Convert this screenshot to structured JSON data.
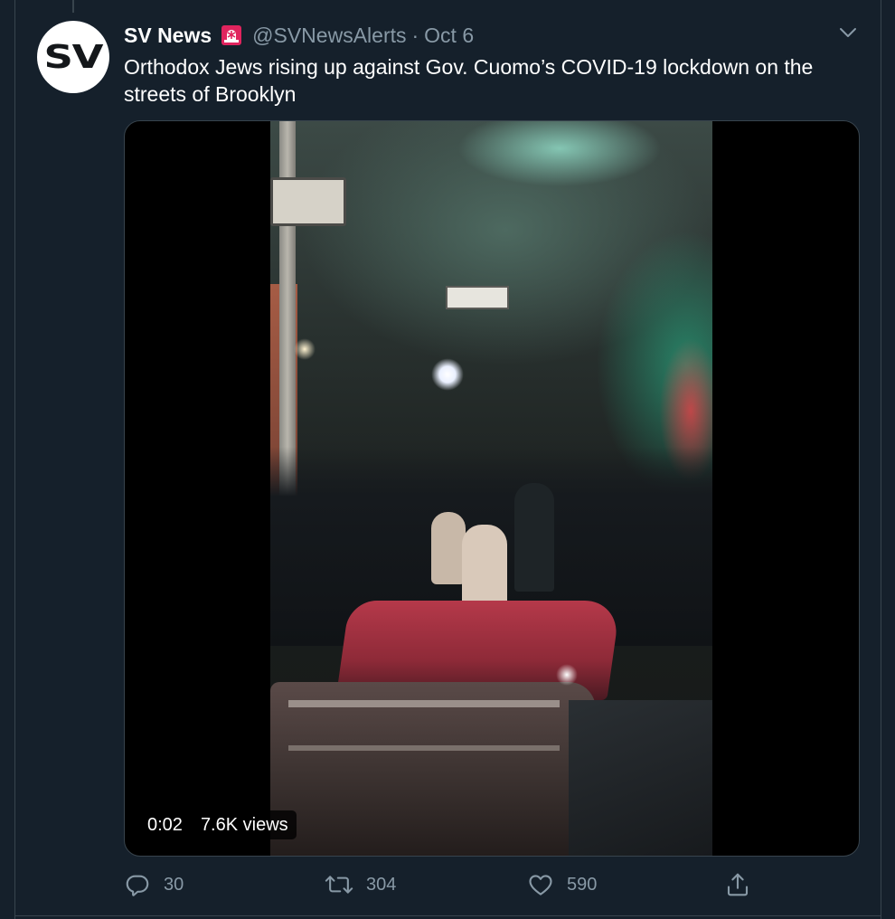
{
  "tweet": {
    "avatar_text": "SV",
    "author_name": "SV News",
    "badge_icon": "rotating-light-icon",
    "handle": "@SVNewsAlerts",
    "separator": "·",
    "date": "Oct 6",
    "text": "Orthodox Jews rising up against Gov. Cuomo’s COVID-19 lockdown on the streets of Brooklyn"
  },
  "video": {
    "duration": "0:02",
    "views": "7.6K views"
  },
  "actions": {
    "reply": {
      "icon": "reply-icon",
      "count": "30"
    },
    "retweet": {
      "icon": "retweet-icon",
      "count": "304"
    },
    "like": {
      "icon": "heart-icon",
      "count": "590"
    },
    "share": {
      "icon": "share-icon"
    }
  },
  "colors": {
    "background": "#15202b",
    "border": "#38444d",
    "secondary_text": "#8899a6",
    "primary_text": "#ffffff"
  }
}
